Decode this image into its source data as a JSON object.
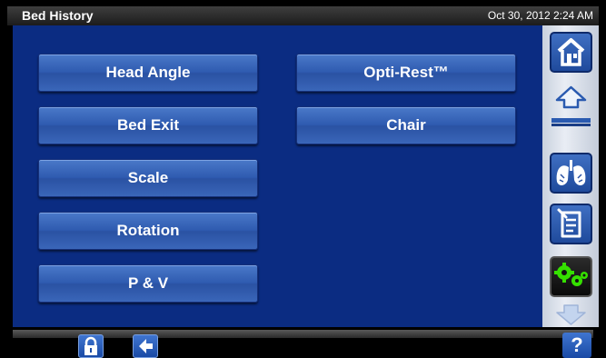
{
  "titlebar": {
    "title": "Bed History",
    "datetime": "Oct 30, 2012 2:24 AM"
  },
  "menu": {
    "head_angle": "Head Angle",
    "bed_exit": "Bed Exit",
    "scale": "Scale",
    "rotation": "Rotation",
    "p_and_v": "P & V",
    "opti_rest": "Opti-Rest™",
    "chair": "Chair"
  },
  "sidebar": {
    "icons": [
      "home-icon",
      "scroll-up-icon",
      "lungs-icon",
      "clipboard-icon",
      "gears-icon",
      "scroll-down-icon"
    ]
  },
  "bottombar": {
    "icons": [
      "lock-icon",
      "back-arrow-icon"
    ],
    "help_label": "?"
  },
  "colors": {
    "background": "#0b2c82",
    "button": "#2f5bb0",
    "gears": "#35e000"
  }
}
